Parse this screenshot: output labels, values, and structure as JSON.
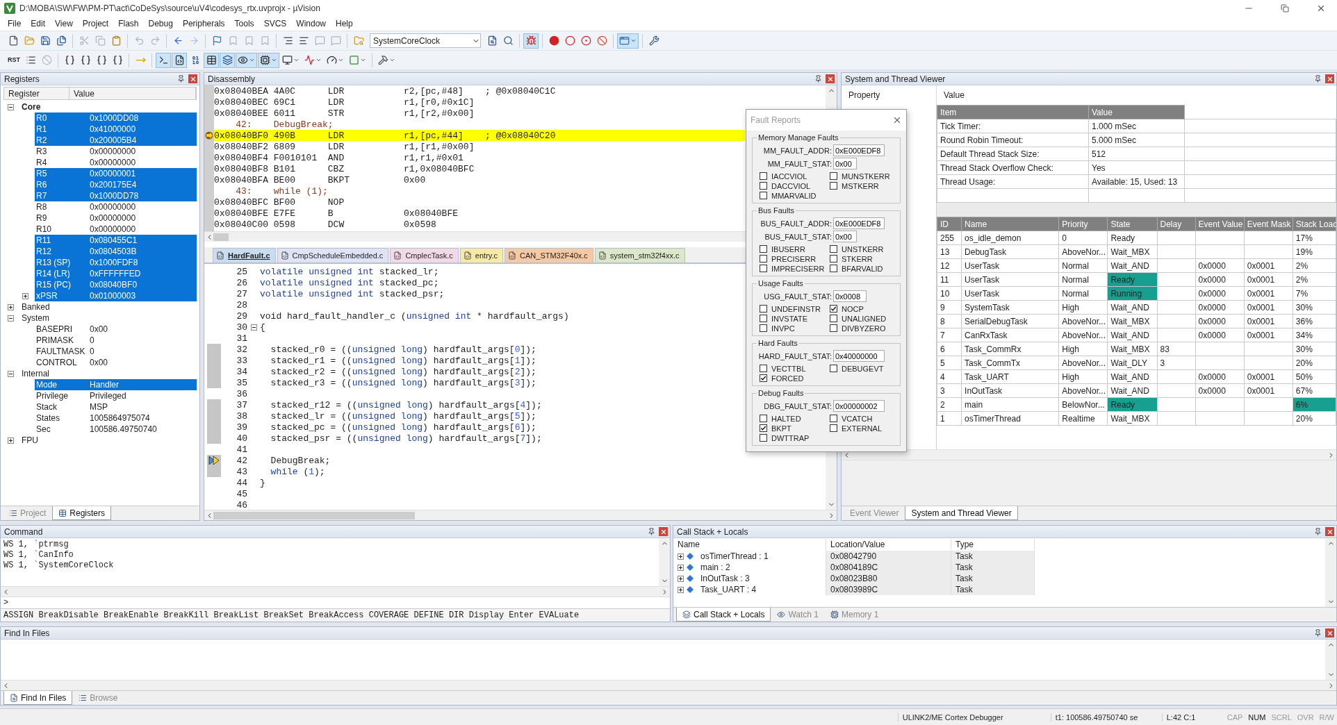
{
  "window": {
    "title": "D:\\MOBA\\SW\\FW\\PM-PT\\act\\CoDeSys\\source\\uV4\\codesys_rtx.uvprojx - µVision"
  },
  "menu": [
    "File",
    "Edit",
    "View",
    "Project",
    "Flash",
    "Debug",
    "Peripherals",
    "Tools",
    "SVCS",
    "Window",
    "Help"
  ],
  "toolbar_1": {
    "combo": "SystemCoreClock",
    "buttons": [
      {
        "on": false,
        "disabled": false
      },
      {
        "on": false,
        "disabled": false
      },
      {
        "on": false,
        "disabled": false
      },
      {
        "on": false,
        "disabled": false
      },
      {
        "on": false,
        "disabled": true
      },
      {
        "on": false,
        "disabled": true
      },
      {
        "on": false,
        "disabled": false
      },
      {
        "on": false,
        "disabled": true
      },
      {
        "on": false,
        "disabled": true
      },
      {
        "on": false,
        "disabled": false
      },
      {
        "on": false,
        "disabled": true
      },
      {
        "on": false,
        "disabled": false
      },
      {
        "on": false,
        "disabled": true
      },
      {
        "on": false,
        "disabled": true
      },
      {
        "on": false,
        "disabled": true
      },
      {
        "on": false,
        "disabled": false
      },
      {
        "on": false,
        "disabled": false
      },
      {
        "on": false,
        "disabled": true
      },
      {
        "on": false,
        "disabled": true
      },
      {
        "on": false,
        "disabled": false
      },
      {
        "on": false,
        "disabled": false
      },
      {
        "on": false,
        "disabled": false
      },
      {
        "on": true,
        "disabled": false
      },
      {
        "on": false,
        "disabled": false
      },
      {
        "on": false,
        "disabled": false
      },
      {
        "on": false,
        "disabled": false
      },
      {
        "on": false,
        "disabled": false
      },
      {
        "on": true,
        "disabled": false
      },
      {
        "on": false,
        "disabled": false
      }
    ]
  },
  "toolbar_2": {
    "reset": "RST",
    "buttons": [
      {
        "on": false,
        "disabled": false
      },
      {
        "on": false,
        "disabled": true
      },
      {
        "on": false,
        "disabled": false
      },
      {
        "on": false,
        "disabled": false
      },
      {
        "on": false,
        "disabled": false
      },
      {
        "on": false,
        "disabled": false
      },
      {
        "on": false,
        "disabled": false
      },
      {
        "on": true,
        "disabled": false
      },
      {
        "on": true,
        "disabled": false
      },
      {
        "on": false,
        "disabled": false
      },
      {
        "on": true,
        "disabled": false
      },
      {
        "on": true,
        "disabled": false
      },
      {
        "on": true,
        "disabled": false
      },
      {
        "on": true,
        "disabled": false
      },
      {
        "on": false,
        "disabled": false
      },
      {
        "on": false,
        "disabled": false
      },
      {
        "on": false,
        "disabled": false
      },
      {
        "on": false,
        "disabled": false
      },
      {
        "on": false,
        "disabled": false
      }
    ]
  },
  "registers": {
    "title": "Registers",
    "columns": [
      "Register",
      "Value"
    ],
    "tree": [
      {
        "name": "Core",
        "expanded": true,
        "children": [
          {
            "name": "R0",
            "value": "0x1000DD08",
            "changed": true
          },
          {
            "name": "R1",
            "value": "0x41000000",
            "changed": true
          },
          {
            "name": "R2",
            "value": "0x200005B4",
            "changed": true
          },
          {
            "name": "R3",
            "value": "0x00000000",
            "changed": false
          },
          {
            "name": "R4",
            "value": "0x00000000",
            "changed": false
          },
          {
            "name": "R5",
            "value": "0x00000001",
            "changed": true
          },
          {
            "name": "R6",
            "value": "0x200175E4",
            "changed": true
          },
          {
            "name": "R7",
            "value": "0x1000DD78",
            "changed": true
          },
          {
            "name": "R8",
            "value": "0x00000000",
            "changed": false
          },
          {
            "name": "R9",
            "value": "0x00000000",
            "changed": false
          },
          {
            "name": "R10",
            "value": "0x00000000",
            "changed": false
          },
          {
            "name": "R11",
            "value": "0x080455C1",
            "changed": true
          },
          {
            "name": "R12",
            "value": "0x0804503B",
            "changed": true
          },
          {
            "name": "R13 (SP)",
            "value": "0x1000FDF8",
            "changed": true
          },
          {
            "name": "R14 (LR)",
            "value": "0xFFFFFFED",
            "changed": true
          },
          {
            "name": "R15 (PC)",
            "value": "0x08040BF0",
            "changed": true
          },
          {
            "name": "xPSR",
            "value": "0x01000003",
            "changed": true,
            "expanded": false
          }
        ]
      },
      {
        "name": "Banked",
        "expanded": false
      },
      {
        "name": "System",
        "expanded": true,
        "children": [
          {
            "name": "BASEPRI",
            "value": "0x00",
            "changed": false
          },
          {
            "name": "PRIMASK",
            "value": "0",
            "changed": false
          },
          {
            "name": "FAULTMASK",
            "value": "0",
            "changed": false
          },
          {
            "name": "CONTROL",
            "value": "0x00",
            "changed": false
          }
        ]
      },
      {
        "name": "Internal",
        "expanded": true,
        "children": [
          {
            "name": "Mode",
            "value": "Handler",
            "changed": true
          },
          {
            "name": "Privilege",
            "value": "Privileged",
            "changed": false
          },
          {
            "name": "Stack",
            "value": "MSP",
            "changed": false
          },
          {
            "name": "States",
            "value": "1005864975074",
            "changed": false
          },
          {
            "name": "Sec",
            "value": "100586.49750740",
            "changed": false
          }
        ]
      },
      {
        "name": "FPU",
        "expanded": false
      }
    ],
    "tabs": [
      {
        "label": "Project",
        "selected": false
      },
      {
        "label": "Registers",
        "selected": true
      }
    ]
  },
  "disassembly": {
    "title": "Disassembly",
    "lines": [
      {
        "kind": "asm",
        "address": "0x08040BEA",
        "code": "4A0C",
        "mnemonic": "LDR",
        "operands": "r2,[pc,#48]",
        "comment": "; @0x08040C1C",
        "current": false
      },
      {
        "kind": "asm",
        "address": "0x08040BEC",
        "code": "69C1",
        "mnemonic": "LDR",
        "operands": "r1,[r0,#0x1C]",
        "current": false
      },
      {
        "kind": "asm",
        "address": "0x08040BEE",
        "code": "6011",
        "mnemonic": "STR",
        "operands": "r1,[r2,#0x00]",
        "current": false
      },
      {
        "kind": "source",
        "number": "42:",
        "text": "DebugBreak;",
        "current": false
      },
      {
        "kind": "asm",
        "address": "0x08040BF0",
        "code": "490B",
        "mnemonic": "LDR",
        "operands": "r1,[pc,#44]",
        "comment": "; @0x08040C20",
        "current": true
      },
      {
        "kind": "asm",
        "address": "0x08040BF2",
        "code": "6809",
        "mnemonic": "LDR",
        "operands": "r1,[r1,#0x00]",
        "current": false
      },
      {
        "kind": "asm",
        "address": "0x08040BF4",
        "code": "F0010101",
        "mnemonic": "AND",
        "operands": "r1,r1,#0x01",
        "current": false
      },
      {
        "kind": "asm",
        "address": "0x08040BF8",
        "code": "B101",
        "mnemonic": "CBZ",
        "operands": "r1,0x08040BFC",
        "current": false
      },
      {
        "kind": "asm",
        "address": "0x08040BFA",
        "code": "BE00",
        "mnemonic": "BKPT",
        "operands": "0x00",
        "current": false
      },
      {
        "kind": "source",
        "number": "43:",
        "text": "while (1);",
        "current": false
      },
      {
        "kind": "asm",
        "address": "0x08040BFC",
        "code": "BF00",
        "mnemonic": "NOP",
        "current": false
      },
      {
        "kind": "asm",
        "address": "0x08040BFE",
        "code": "E7FE",
        "mnemonic": "B",
        "operands": "0x08040BFE",
        "current": false
      },
      {
        "kind": "asm",
        "address": "0x08040C00",
        "code": "0598",
        "mnemonic": "DCW",
        "operands": "0x0598",
        "current": false
      }
    ]
  },
  "editor": {
    "tabs": [
      {
        "label": "HardFault.c",
        "selected": true,
        "color": "#c9dcf0"
      },
      {
        "label": "CmpScheduleEmbedded.c",
        "selected": false,
        "color": "#dfe3f5"
      },
      {
        "label": "CmplecTask.c",
        "selected": false,
        "color": "#f2d9e6"
      },
      {
        "label": "entry.c",
        "selected": false,
        "color": "#f7e9a6"
      },
      {
        "label": "CAN_STM32F40x.c",
        "selected": false,
        "color": "#f5c9a3"
      },
      {
        "label": "system_stm32f4xx.c",
        "selected": false,
        "color": "#dce6c8"
      }
    ],
    "lines": [
      {
        "number": "25",
        "segments": [
          {
            "kind": "keyword",
            "text": "volatile unsigned int"
          },
          {
            "kind": "plain",
            "text": " stacked_lr;"
          }
        ],
        "covered": false,
        "current": false,
        "fold": false
      },
      {
        "number": "26",
        "segments": [
          {
            "kind": "keyword",
            "text": "volatile unsigned int"
          },
          {
            "kind": "plain",
            "text": " stacked_pc;"
          }
        ],
        "covered": false,
        "current": false,
        "fold": false
      },
      {
        "number": "27",
        "segments": [
          {
            "kind": "keyword",
            "text": "volatile unsigned int"
          },
          {
            "kind": "plain",
            "text": " stacked_psr;"
          }
        ],
        "covered": false,
        "current": false,
        "fold": false
      },
      {
        "number": "28",
        "covered": false,
        "current": false,
        "fold": false
      },
      {
        "number": "29",
        "segments": [
          {
            "kind": "plain",
            "text": "void hard_fault_handler_c ("
          },
          {
            "kind": "keyword",
            "text": "unsigned int"
          },
          {
            "kind": "plain",
            "text": " * hardfault_args)"
          }
        ],
        "covered": false,
        "current": false,
        "fold": false
      },
      {
        "number": "30",
        "segments": [
          {
            "kind": "plain",
            "text": "{"
          }
        ],
        "covered": false,
        "current": false,
        "fold": true
      },
      {
        "number": "31",
        "covered": false,
        "current": false,
        "fold": false
      },
      {
        "number": "32",
        "segments": [
          {
            "kind": "plain",
            "text": "  stacked_r0 = (("
          },
          {
            "kind": "keyword",
            "text": "unsigned long"
          },
          {
            "kind": "plain",
            "text": ") hardfault_args["
          },
          {
            "kind": "number",
            "text": "0"
          },
          {
            "kind": "plain",
            "text": "]);"
          }
        ],
        "covered": true,
        "current": false,
        "fold": false
      },
      {
        "number": "33",
        "segments": [
          {
            "kind": "plain",
            "text": "  stacked_r1 = (("
          },
          {
            "kind": "keyword",
            "text": "unsigned long"
          },
          {
            "kind": "plain",
            "text": ") hardfault_args["
          },
          {
            "kind": "number",
            "text": "1"
          },
          {
            "kind": "plain",
            "text": "]);"
          }
        ],
        "covered": true,
        "current": false,
        "fold": false
      },
      {
        "number": "34",
        "segments": [
          {
            "kind": "plain",
            "text": "  stacked_r2 = (("
          },
          {
            "kind": "keyword",
            "text": "unsigned long"
          },
          {
            "kind": "plain",
            "text": ") hardfault_args["
          },
          {
            "kind": "number",
            "text": "2"
          },
          {
            "kind": "plain",
            "text": "]);"
          }
        ],
        "covered": true,
        "current": false,
        "fold": false
      },
      {
        "number": "35",
        "segments": [
          {
            "kind": "plain",
            "text": "  stacked_r3 = (("
          },
          {
            "kind": "keyword",
            "text": "unsigned long"
          },
          {
            "kind": "plain",
            "text": ") hardfault_args["
          },
          {
            "kind": "number",
            "text": "3"
          },
          {
            "kind": "plain",
            "text": "]);"
          }
        ],
        "covered": true,
        "current": false,
        "fold": false
      },
      {
        "number": "36",
        "covered": false,
        "current": false,
        "fold": false
      },
      {
        "number": "37",
        "segments": [
          {
            "kind": "plain",
            "text": "  stacked_r12 = (("
          },
          {
            "kind": "keyword",
            "text": "unsigned long"
          },
          {
            "kind": "plain",
            "text": ") hardfault_args["
          },
          {
            "kind": "number",
            "text": "4"
          },
          {
            "kind": "plain",
            "text": "]);"
          }
        ],
        "covered": true,
        "current": false,
        "fold": false
      },
      {
        "number": "38",
        "segments": [
          {
            "kind": "plain",
            "text": "  stacked_lr = (("
          },
          {
            "kind": "keyword",
            "text": "unsigned long"
          },
          {
            "kind": "plain",
            "text": ") hardfault_args["
          },
          {
            "kind": "number",
            "text": "5"
          },
          {
            "kind": "plain",
            "text": "]);"
          }
        ],
        "covered": true,
        "current": false,
        "fold": false
      },
      {
        "number": "39",
        "segments": [
          {
            "kind": "plain",
            "text": "  stacked_pc = (("
          },
          {
            "kind": "keyword",
            "text": "unsigned long"
          },
          {
            "kind": "plain",
            "text": ") hardfault_args["
          },
          {
            "kind": "number",
            "text": "6"
          },
          {
            "kind": "plain",
            "text": "]);"
          }
        ],
        "covered": true,
        "current": false,
        "fold": false
      },
      {
        "number": "40",
        "segments": [
          {
            "kind": "plain",
            "text": "  stacked_psr = (("
          },
          {
            "kind": "keyword",
            "text": "unsigned long"
          },
          {
            "kind": "plain",
            "text": ") hardfault_args["
          },
          {
            "kind": "number",
            "text": "7"
          },
          {
            "kind": "plain",
            "text": "]);"
          }
        ],
        "covered": true,
        "current": false,
        "fold": false
      },
      {
        "number": "41",
        "covered": false,
        "current": false,
        "fold": false
      },
      {
        "number": "42",
        "segments": [
          {
            "kind": "plain",
            "text": "  DebugBreak;"
          }
        ],
        "covered": true,
        "current": true,
        "fold": false
      },
      {
        "number": "43",
        "segments": [
          {
            "kind": "keyword",
            "text": "  while"
          },
          {
            "kind": "plain",
            "text": " ("
          },
          {
            "kind": "number",
            "text": "1"
          },
          {
            "kind": "plain",
            "text": ");"
          }
        ],
        "covered": true,
        "current": false,
        "fold": false
      },
      {
        "number": "44",
        "segments": [
          {
            "kind": "plain",
            "text": "}"
          }
        ],
        "covered": false,
        "current": false,
        "fold": false
      },
      {
        "number": "45",
        "covered": false,
        "current": false,
        "fold": false
      },
      {
        "number": "46",
        "covered": false,
        "current": false,
        "fold": false
      }
    ]
  },
  "fault_reports": {
    "title": "Fault Reports",
    "groups": [
      {
        "title": "Memory Manage Faults",
        "fields": [
          {
            "label": "MM_FAULT_ADDR:",
            "value": "0xE000EDF8"
          },
          {
            "label": "MM_FAULT_STAT:",
            "value": "0x00"
          }
        ],
        "flags": [
          {
            "label": "IACCVIOL",
            "checked": false
          },
          {
            "label": "MUNSTKERR",
            "checked": false
          },
          {
            "label": "DACCVIOL",
            "checked": false
          },
          {
            "label": "MSTKERR",
            "checked": false
          },
          {
            "label": "MMARVALID",
            "checked": false
          }
        ]
      },
      {
        "title": "Bus Faults",
        "fields": [
          {
            "label": "BUS_FAULT_ADDR:",
            "value": "0xE000EDF8"
          },
          {
            "label": "BUS_FAULT_STAT:",
            "value": "0x00"
          }
        ],
        "flags": [
          {
            "label": "IBUSERR",
            "checked": false
          },
          {
            "label": "UNSTKERR",
            "checked": false
          },
          {
            "label": "PRECISERR",
            "checked": false
          },
          {
            "label": "STKERR",
            "checked": false
          },
          {
            "label": "IMPRECISERR",
            "checked": false
          },
          {
            "label": "BFARVALID",
            "checked": false
          }
        ]
      },
      {
        "title": "Usage Faults",
        "fields": [
          {
            "label": "USG_FAULT_STAT:",
            "value": "0x0008"
          }
        ],
        "flags": [
          {
            "label": "UNDEFINSTR",
            "checked": false
          },
          {
            "label": "NOCP",
            "checked": true
          },
          {
            "label": "INVSTATE",
            "checked": false
          },
          {
            "label": "UNALIGNED",
            "checked": false
          },
          {
            "label": "INVPC",
            "checked": false
          },
          {
            "label": "DIVBYZERO",
            "checked": false
          }
        ]
      },
      {
        "title": "Hard Faults",
        "fields": [
          {
            "label": "HARD_FAULT_STAT:",
            "value": "0x40000000"
          }
        ],
        "flags": [
          {
            "label": "VECTTBL",
            "checked": false
          },
          {
            "label": "DEBUGEVT",
            "checked": false
          },
          {
            "label": "FORCED",
            "checked": true
          }
        ]
      },
      {
        "title": "Debug Faults",
        "fields": [
          {
            "label": "DBG_FAULT_STAT:",
            "value": "0x00000002"
          }
        ],
        "flags": [
          {
            "label": "HALTED",
            "checked": false
          },
          {
            "label": "VCATCH",
            "checked": false
          },
          {
            "label": "BKPT",
            "checked": true
          },
          {
            "label": "EXTERNAL",
            "checked": false
          },
          {
            "label": "DWTTRAP",
            "checked": false
          }
        ]
      }
    ]
  },
  "thread_viewer": {
    "title": "System and Thread Viewer",
    "property_columns": [
      "Property",
      "Value"
    ],
    "info": {
      "columns": [
        "Item",
        "Value"
      ],
      "rows": [
        [
          "Tick Timer:",
          "1.000 mSec"
        ],
        [
          "Round Robin Timeout:",
          "5.000 mSec"
        ],
        [
          "Default Thread Stack Size:",
          "512"
        ],
        [
          "Thread Stack Overflow Check:",
          "Yes"
        ],
        [
          "Thread Usage:",
          "Available: 15, Used: 13"
        ]
      ]
    },
    "threads": {
      "columns": [
        "ID",
        "Name",
        "Priority",
        "State",
        "Delay",
        "Event Value",
        "Event Mask",
        "Stack Load"
      ],
      "rows": [
        {
          "id": "255",
          "name": "os_idle_demon",
          "priority": "0",
          "state": "Ready",
          "stack_load": "17%",
          "state_changed": false,
          "load_changed": false
        },
        {
          "id": "13",
          "name": "DebugTask",
          "priority": "AboveNor...",
          "state": "Wait_MBX",
          "stack_load": "19%",
          "state_changed": false,
          "load_changed": false
        },
        {
          "id": "12",
          "name": "UserTask",
          "priority": "Normal",
          "state": "Wait_AND",
          "event_value": "0x0000",
          "event_mask": "0x0001",
          "stack_load": "2%",
          "state_changed": false,
          "load_changed": false
        },
        {
          "id": "11",
          "name": "UserTask",
          "priority": "Normal",
          "state": "Ready",
          "event_value": "0x0000",
          "event_mask": "0x0001",
          "stack_load": "2%",
          "state_changed": true,
          "load_changed": false
        },
        {
          "id": "10",
          "name": "UserTask",
          "priority": "Normal",
          "state": "Running",
          "event_value": "0x0000",
          "event_mask": "0x0001",
          "stack_load": "7%",
          "state_changed": true,
          "load_changed": false
        },
        {
          "id": "9",
          "name": "SystemTask",
          "priority": "High",
          "state": "Wait_AND",
          "event_value": "0x0000",
          "event_mask": "0x0001",
          "stack_load": "30%",
          "state_changed": false,
          "load_changed": false
        },
        {
          "id": "8",
          "name": "SerialDebugTask",
          "priority": "AboveNor...",
          "state": "Wait_MBX",
          "event_value": "0x0000",
          "event_mask": "0x0001",
          "stack_load": "36%",
          "state_changed": false,
          "load_changed": false
        },
        {
          "id": "7",
          "name": "CanRxTask",
          "priority": "AboveNor...",
          "state": "Wait_AND",
          "event_value": "0x0000",
          "event_mask": "0x0001",
          "stack_load": "34%",
          "state_changed": false,
          "load_changed": false
        },
        {
          "id": "6",
          "name": "Task_CommRx",
          "priority": "High",
          "state": "Wait_MBX",
          "delay": "83",
          "stack_load": "30%",
          "state_changed": false,
          "load_changed": false
        },
        {
          "id": "5",
          "name": "Task_CommTx",
          "priority": "AboveNor...",
          "state": "Wait_DLY",
          "delay": "3",
          "stack_load": "20%",
          "state_changed": false,
          "load_changed": false
        },
        {
          "id": "4",
          "name": "Task_UART",
          "priority": "High",
          "state": "Wait_AND",
          "event_value": "0x0000",
          "event_mask": "0x0001",
          "stack_load": "50%",
          "state_changed": false,
          "load_changed": false
        },
        {
          "id": "3",
          "name": "InOutTask",
          "priority": "AboveNor...",
          "state": "Wait_AND",
          "event_value": "0x0000",
          "event_mask": "0x0001",
          "stack_load": "67%",
          "state_changed": false,
          "load_changed": false
        },
        {
          "id": "2",
          "name": "main",
          "priority": "BelowNor...",
          "state": "Ready",
          "stack_load": "6%",
          "state_changed": true,
          "load_changed": true
        },
        {
          "id": "1",
          "name": "osTimerThread",
          "priority": "Realtime",
          "state": "Wait_MBX",
          "stack_load": "20%",
          "state_changed": false,
          "load_changed": false
        }
      ]
    },
    "tabs": [
      {
        "label": "Event Viewer",
        "selected": false
      },
      {
        "label": "System and Thread Viewer",
        "selected": true
      }
    ]
  },
  "command": {
    "title": "Command",
    "lines": [
      "WS 1, `ptrmsg",
      "WS 1, `CanInfo",
      "WS 1, `SystemCoreClock"
    ],
    "prompt": ">",
    "help": "ASSIGN BreakDisable BreakEnable BreakKill BreakList BreakSet BreakAccess COVERAGE DEFINE DIR Display Enter EVALuate"
  },
  "call_stack": {
    "title": "Call Stack + Locals",
    "columns": [
      "Name",
      "Location/Value",
      "Type"
    ],
    "rows": [
      {
        "name": "osTimerThread : 1",
        "value": "0x08042790",
        "type": "Task",
        "expanded": false
      },
      {
        "name": "main : 2",
        "value": "0x0804189C",
        "type": "Task",
        "expanded": false
      },
      {
        "name": "InOutTask : 3",
        "value": "0x08023B80",
        "type": "Task",
        "expanded": false
      },
      {
        "name": "Task_UART : 4",
        "value": "0x0803989C",
        "type": "Task",
        "expanded": false
      }
    ],
    "tabs": [
      {
        "label": "Call Stack + Locals",
        "selected": true
      },
      {
        "label": "Watch 1",
        "selected": false
      },
      {
        "label": "Memory 1",
        "selected": false
      }
    ]
  },
  "find_in_files": {
    "title": "Find In Files",
    "tabs": [
      {
        "label": "Find In Files",
        "selected": true
      },
      {
        "label": "Browse",
        "selected": false
      }
    ]
  },
  "status_bar": {
    "debugger": "ULINK2/ME Cortex Debugger",
    "time": "t1: 100586.49750740 se",
    "position": "L:42 C:1",
    "indicators": [
      {
        "label": "CAP",
        "on": false
      },
      {
        "label": "NUM",
        "on": true
      },
      {
        "label": "SCRL",
        "on": false
      },
      {
        "label": "OVR",
        "on": false
      },
      {
        "label": "R/W",
        "on": false
      }
    ]
  }
}
